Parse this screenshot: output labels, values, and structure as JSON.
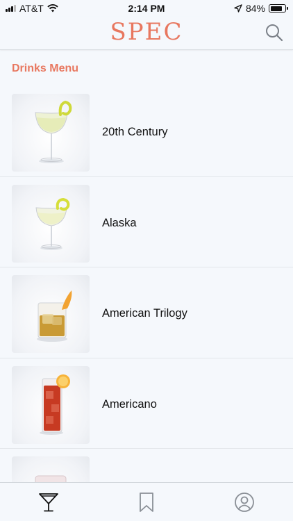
{
  "status": {
    "carrier": "AT&T",
    "time": "2:14 PM",
    "battery": "84%",
    "battery_level": 0.84,
    "icons": [
      "signal-icon",
      "wifi-icon",
      "location-arrow-icon",
      "battery-icon"
    ]
  },
  "header": {
    "logo": "SPEC",
    "brand_color": "#e8775f",
    "search_icon": "search-icon"
  },
  "section": {
    "title": "Drinks Menu"
  },
  "drinks": [
    {
      "name": "20th Century",
      "image": "coupe-glass-lemon-twist"
    },
    {
      "name": "Alaska",
      "image": "coupe-glass-lemon-twist"
    },
    {
      "name": "American Trilogy",
      "image": "rocks-glass-orange-peel"
    },
    {
      "name": "Americano",
      "image": "highball-glass-orange-slice"
    },
    {
      "name": "",
      "image": "partial-glass"
    }
  ],
  "tabs": [
    {
      "name": "tab-drinks",
      "icon": "martini-glass-icon",
      "active": true
    },
    {
      "name": "tab-saved",
      "icon": "bookmark-icon",
      "active": false
    },
    {
      "name": "tab-profile",
      "icon": "user-circle-icon",
      "active": false
    }
  ]
}
